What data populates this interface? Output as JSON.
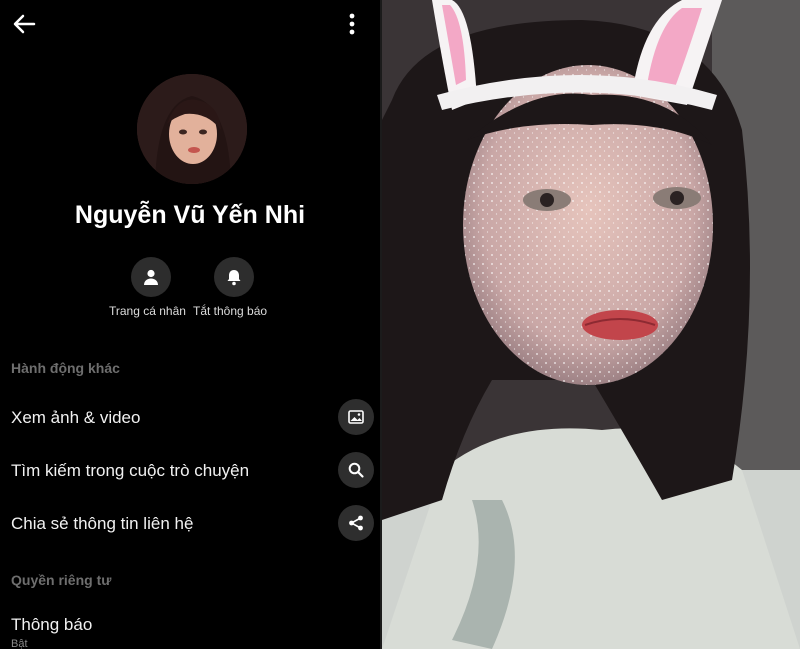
{
  "profile": {
    "name": "Nguyễn Vũ Yến Nhi",
    "actions": [
      {
        "label": "Trang cá nhân",
        "icon": "person-icon"
      },
      {
        "label": "Tắt thông báo",
        "icon": "bell-icon"
      }
    ]
  },
  "sections": {
    "more_actions_title": "Hành động khác",
    "privacy_title": "Quyền riêng tư"
  },
  "menu": [
    {
      "label": "Xem ảnh & video",
      "icon": "image-icon"
    },
    {
      "label": "Tìm kiếm trong cuộc trò chuyện",
      "icon": "search-icon"
    },
    {
      "label": "Chia sẻ thông tin liên hệ",
      "icon": "share-icon"
    }
  ],
  "notifications": {
    "label": "Thông báo",
    "status": "Bật"
  }
}
